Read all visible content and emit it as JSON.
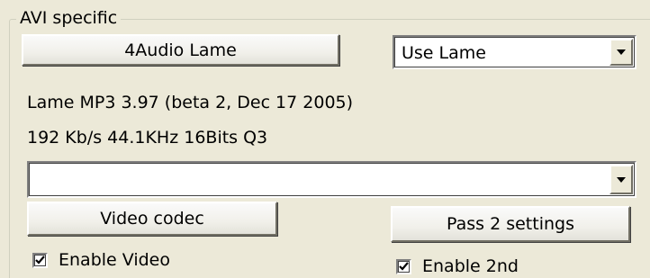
{
  "group": {
    "title": "AVI specific"
  },
  "audio": {
    "button_label": "4Audio Lame",
    "mode_select_value": "Use Lame",
    "info_line1": "Lame MP3 3.97 (beta 2, Dec 17 2005)",
    "info_line2": "192 Kb/s 44.1KHz 16Bits Q3"
  },
  "video": {
    "codec_select_value": "",
    "codec_button_label": "Video codec",
    "enable_label": "Enable Video",
    "enable_checked": true
  },
  "pass2": {
    "button_label": "Pass 2 settings",
    "enable_label": "Enable 2nd",
    "enable_checked": true
  },
  "icons": {
    "dropdown": "chevron-down-icon",
    "check": "check-icon"
  }
}
